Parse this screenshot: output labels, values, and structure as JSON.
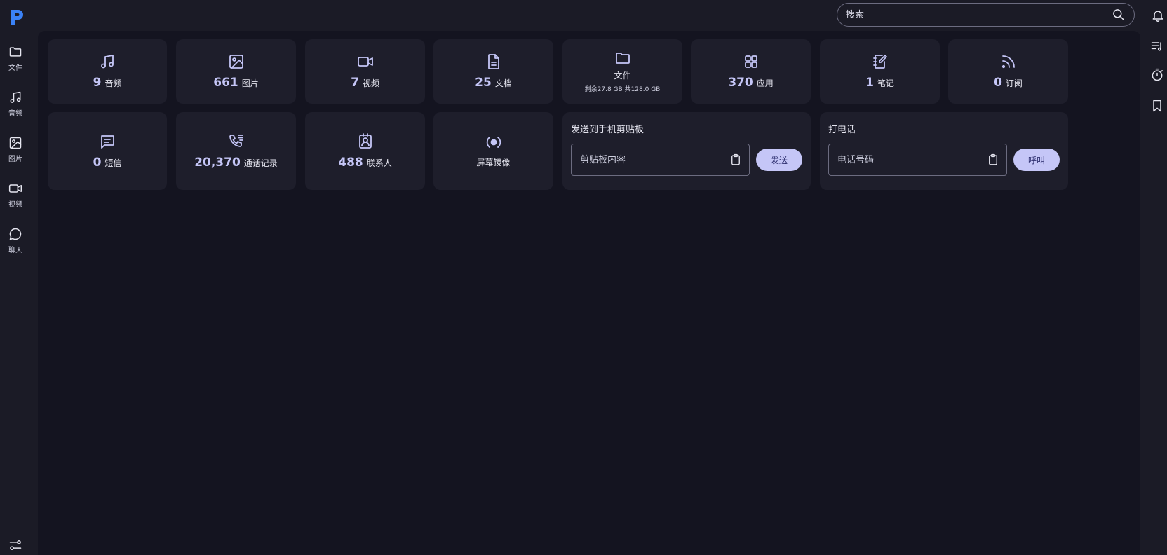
{
  "app": {
    "logo_letter": "P",
    "brand_color": "#3b82f6"
  },
  "search": {
    "placeholder": "搜索"
  },
  "left_nav": [
    {
      "label": "文件",
      "icon": "folder-icon"
    },
    {
      "label": "音频",
      "icon": "music-icon"
    },
    {
      "label": "图片",
      "icon": "image-icon"
    },
    {
      "label": "视频",
      "icon": "video-icon"
    },
    {
      "label": "聊天",
      "icon": "chat-icon"
    }
  ],
  "right_nav": [
    "playlist-icon",
    "timer-icon",
    "bookmark-icon"
  ],
  "stats_row1": [
    {
      "count": "9",
      "label": "音频",
      "icon": "music-icon"
    },
    {
      "count": "661",
      "label": "图片",
      "icon": "image-icon"
    },
    {
      "count": "7",
      "label": "视频",
      "icon": "video-icon"
    },
    {
      "count": "25",
      "label": "文档",
      "icon": "document-icon"
    },
    {
      "label": "文件",
      "sub": "剩余27.8 GB 共128.0 GB",
      "icon": "folder-icon"
    },
    {
      "count": "370",
      "label": "应用",
      "icon": "apps-grid-icon"
    },
    {
      "count": "1",
      "label": "笔记",
      "icon": "note-icon"
    },
    {
      "count": "0",
      "label": "订阅",
      "icon": "rss-icon"
    }
  ],
  "stats_row2": [
    {
      "count": "0",
      "label": "短信",
      "icon": "message-icon"
    },
    {
      "count": "20,370",
      "label": "通话记录",
      "icon": "call-log-icon"
    },
    {
      "count": "488",
      "label": "联系人",
      "icon": "contact-icon"
    },
    {
      "label": "屏幕镜像",
      "icon": "screen-mirror-icon"
    }
  ],
  "clipboard": {
    "title": "发送到手机剪贴板",
    "placeholder": "剪贴板内容",
    "button": "发送"
  },
  "call": {
    "title": "打电话",
    "placeholder": "电话号码",
    "button": "呼叫"
  },
  "colors": {
    "accent": "#c5c6f7",
    "background": "#1b1b26",
    "panel": "#141420",
    "card": "#1e1e2b"
  }
}
